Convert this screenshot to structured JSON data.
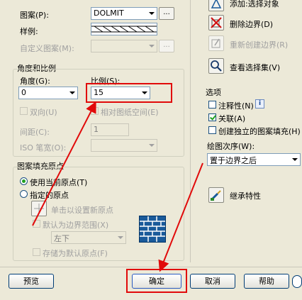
{
  "pattern": {
    "pattern_label": "图案(P):",
    "pattern_value": "DOLMIT",
    "pattern_ellipsis": "...",
    "swatch_label": "样例:",
    "custom_label": "自定义图案(M):",
    "custom_ellipsis": "..."
  },
  "angle_scale": {
    "group_title": "角度和比例",
    "angle_label": "角度(G):",
    "angle_value": "0",
    "scale_label": "比例(S):",
    "scale_value": "15",
    "double_label": "双向(U)",
    "relative_label": "相对图纸空间(E)",
    "spacing_label": "间距(C):",
    "spacing_value": "1",
    "iso_label": "ISO 笔宽(O):"
  },
  "origin": {
    "group_title": "图案填充原点",
    "use_current_label": "使用当前原点(T)",
    "specified_label": "指定的原点",
    "click_set_label": "单击以设置新原点",
    "default_extent_label": "默认为边界范围(X)",
    "position_value": "左下",
    "store_label": "存储为默认原点(F)"
  },
  "right_panel": {
    "add_select_label": "添加:选择对象",
    "remove_label": "删除边界(D)",
    "recreate_label": "重新创建边界(R)",
    "view_sel_label": "查看选择集(V)",
    "options_title": "选项",
    "annotative_label": "注释性(N)",
    "info_glyph": "i",
    "assoc_label": "关联(A)",
    "independent_label": "创建独立的图案填充(H)",
    "draw_order_label": "绘图次序(W):",
    "draw_order_value": "置于边界之后",
    "inherit_label": "继承特性"
  },
  "footer": {
    "preview_label": "预览",
    "ok_label": "确定",
    "cancel_label": "取消",
    "help_label": "帮助"
  },
  "colors": {
    "highlight_red": "#e10a0a",
    "check_green": "#21a121",
    "dialog_bg": "#ece9d8"
  }
}
